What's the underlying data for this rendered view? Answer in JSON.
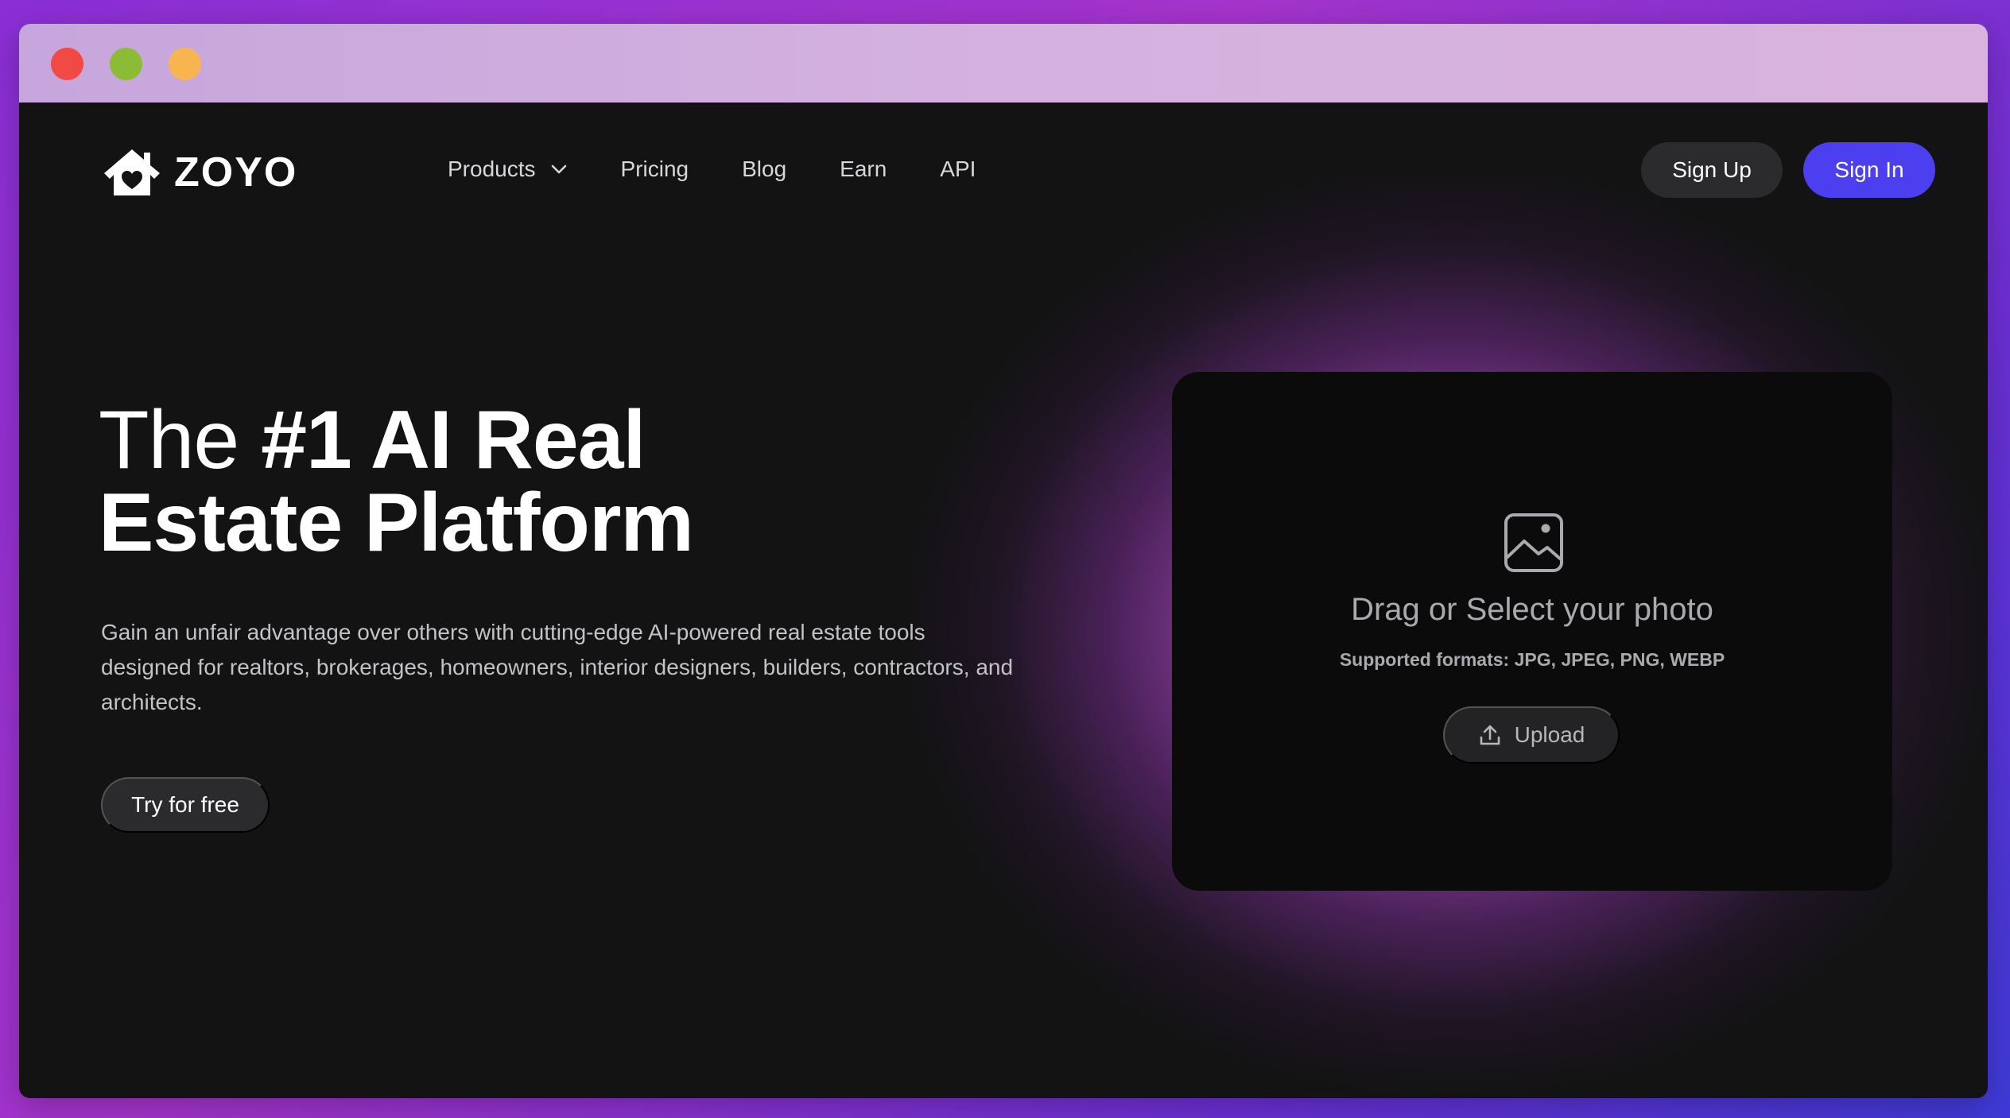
{
  "window": {
    "controls": [
      "close",
      "minimize",
      "maximize"
    ]
  },
  "brand": {
    "name": "ZOYO",
    "logo_icon": "house-heart-icon"
  },
  "nav": {
    "items": [
      {
        "label": "Products",
        "has_dropdown": true
      },
      {
        "label": "Pricing"
      },
      {
        "label": "Blog"
      },
      {
        "label": "Earn"
      },
      {
        "label": "API"
      }
    ]
  },
  "auth": {
    "signup_label": "Sign Up",
    "signin_label": "Sign In"
  },
  "hero": {
    "title_light": "The ",
    "title_bold_1": "#1 AI Real",
    "title_bold_2": "Estate Platform",
    "subtitle": "Gain an unfair advantage over others with cutting-edge AI-powered real estate tools designed for realtors, brokerages, homeowners, interior designers, builders, contractors, and architects.",
    "cta_label": "Try for free"
  },
  "uploader": {
    "icon": "image-icon",
    "title": "Drag or Select your photo",
    "formats": "Supported formats: JPG, JPEG, PNG, WEBP",
    "button_label": "Upload",
    "button_icon": "upload-icon"
  },
  "colors": {
    "accent": "#4b3ff0",
    "page_bg": "#131314",
    "card_bg": "#0b0b0c",
    "glow": "#c95ae0"
  }
}
